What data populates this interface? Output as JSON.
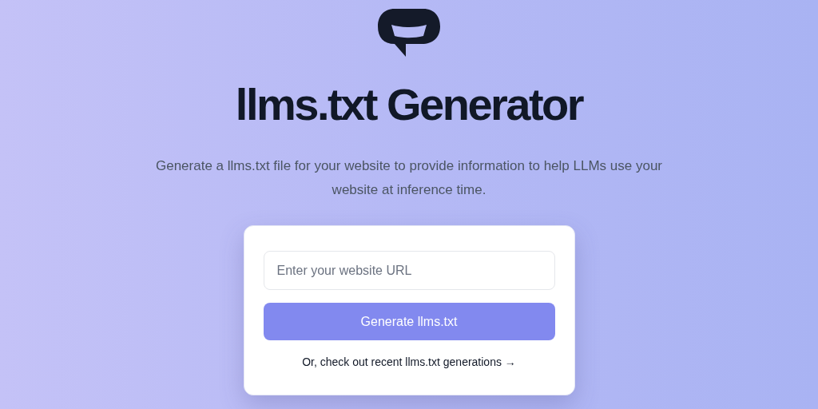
{
  "title": "llms.txt Generator",
  "description": "Generate a llms.txt file for your website to provide information to help LLMs use your website at inference time.",
  "form": {
    "url_field": {
      "placeholder": "Enter your website URL"
    },
    "submit_button": "Generate llms.txt",
    "recent_link": "Or, check out recent llms.txt generations →"
  }
}
